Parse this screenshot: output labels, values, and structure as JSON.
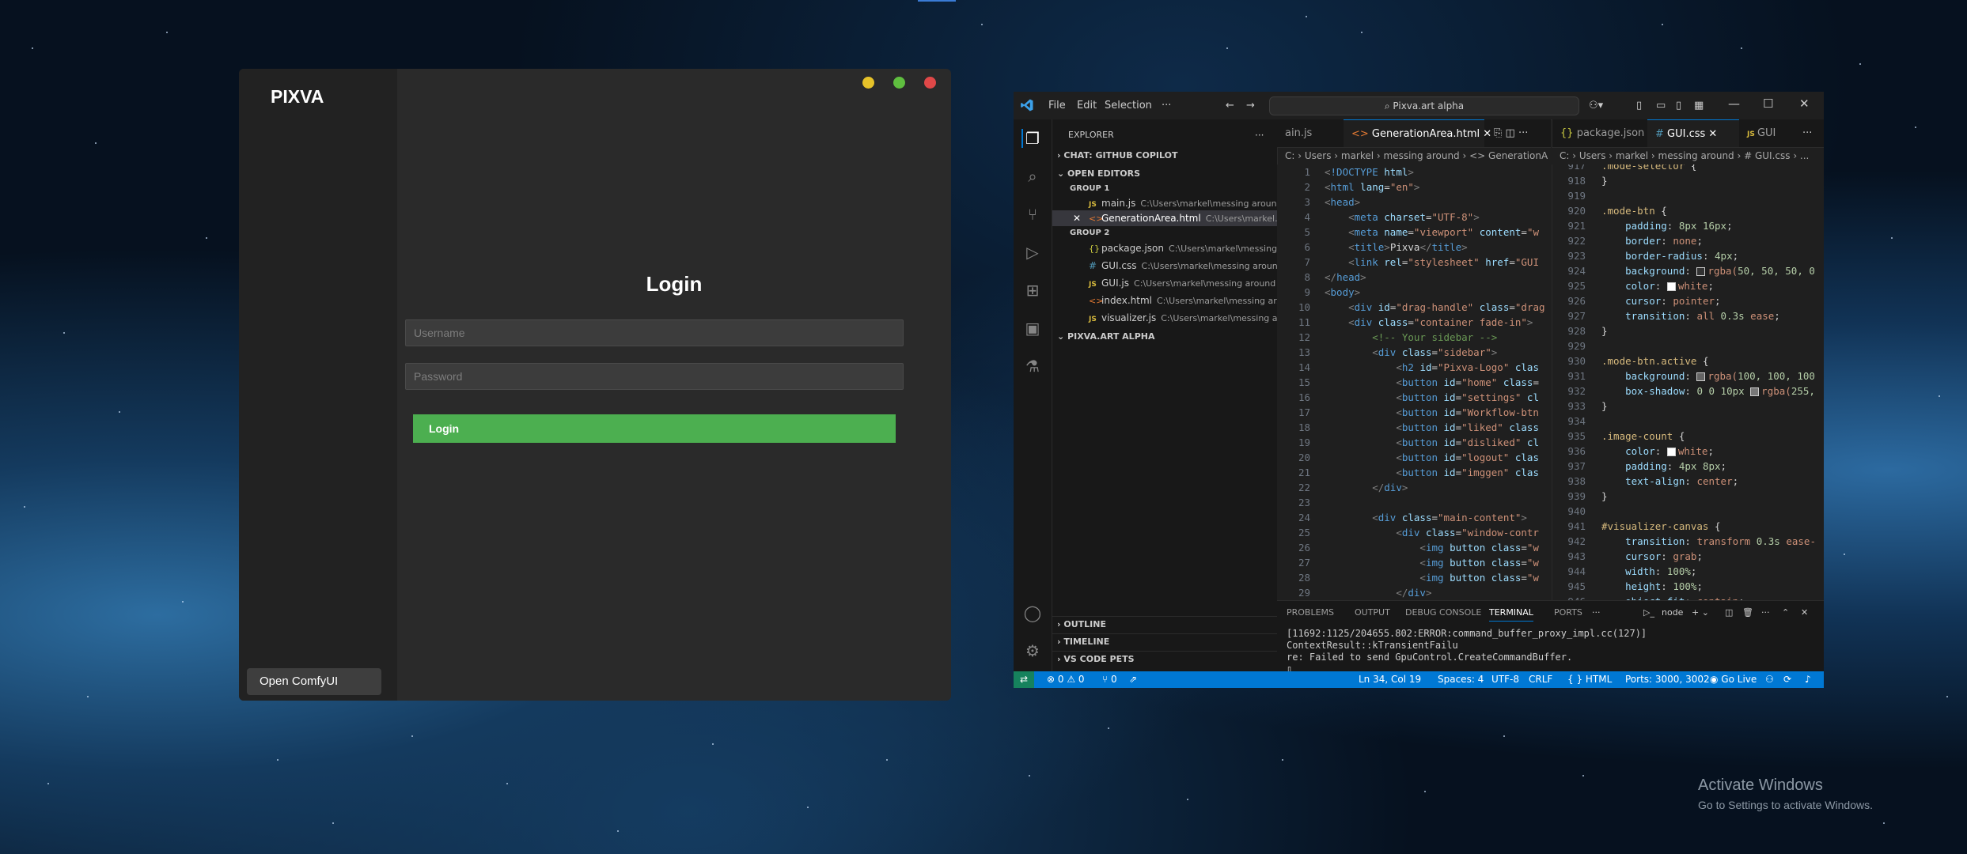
{
  "pixva": {
    "logo": "PIXVA",
    "title": "Login",
    "username_placeholder": "Username",
    "password_placeholder": "Password",
    "login_button": "Login",
    "comfy_button": "Open ComfyUI",
    "controls": {
      "minimize": "#e6c229",
      "maximize": "#5fbe3f",
      "close": "#e04848"
    }
  },
  "vscode": {
    "menu": [
      "File",
      "Edit",
      "Selection",
      "···"
    ],
    "search": "Pixva.art alpha",
    "explorer": {
      "title": "EXPLORER",
      "chat": "CHAT: GITHUB COPILOT",
      "open_editors": "OPEN EDITORS",
      "group1": "GROUP 1",
      "group2": "GROUP 2",
      "group1_files": [
        {
          "name": "main.js",
          "path": "C:\\Users\\markel\\messing around",
          "icon": "JS"
        },
        {
          "name": "GenerationArea.html",
          "path": "C:\\Users\\markel...",
          "icon": "<>"
        }
      ],
      "group2_files": [
        {
          "name": "package.json",
          "path": "C:\\Users\\markel\\messing...",
          "icon": "{}"
        },
        {
          "name": "GUI.css",
          "path": "C:\\Users\\markel\\messing around",
          "icon": "#"
        },
        {
          "name": "GUI.js",
          "path": "C:\\Users\\markel\\messing around",
          "icon": "JS"
        },
        {
          "name": "index.html",
          "path": "C:\\Users\\markel\\messing ar...",
          "icon": "<>"
        },
        {
          "name": "visualizer.js",
          "path": "C:\\Users\\markel\\messing a...",
          "icon": "JS"
        }
      ],
      "workspace": "PIXVA.ART ALPHA",
      "outline": "OUTLINE",
      "timeline": "TIMELINE",
      "pets": "VS CODE PETS"
    },
    "tabs_left": [
      "ain.js",
      "GenerationArea.html"
    ],
    "tabs_right": [
      "package.json",
      "GUI.css",
      "GUI"
    ],
    "breadcrumb_left": "C: › Users › markel › messing around › <> GenerationA",
    "breadcrumb_right": "C: › Users › markel › messing around › # GUI.css › ...",
    "panel": {
      "tabs": [
        "PROBLEMS",
        "OUTPUT",
        "DEBUG CONSOLE",
        "TERMINAL",
        "PORTS"
      ],
      "shell": "node",
      "line1": "[11692:1125/204655.802:ERROR:command_buffer_proxy_impl.cc(127)] ContextResult::kTransientFailu",
      "line2": "re: Failed to send GpuControl.CreateCommandBuffer."
    },
    "status": {
      "errors": "⊗ 0 ⚠ 0",
      "ports_icon": "⑂ 0",
      "position": "Ln 34, Col 19",
      "spaces": "Spaces: 4",
      "encoding": "UTF-8",
      "eol": "CRLF",
      "lang": "{ } HTML",
      "ports": "Ports: 3000, 3002",
      "golive": "Go Live"
    }
  },
  "watermark": {
    "line1": "Activate Windows",
    "line2": "Go to Settings to activate Windows."
  }
}
